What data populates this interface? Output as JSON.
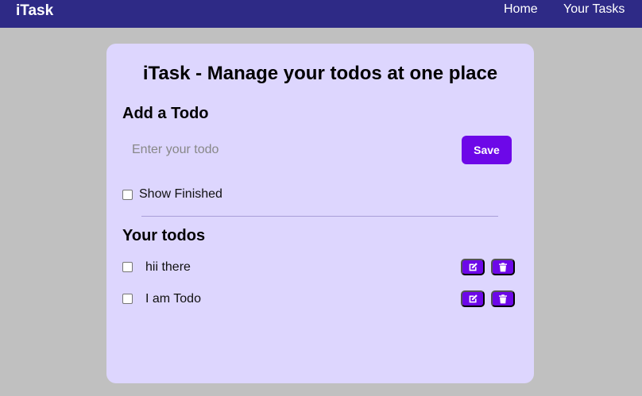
{
  "navbar": {
    "brand": "iTask",
    "links": [
      {
        "label": "Home"
      },
      {
        "label": "Your Tasks"
      }
    ]
  },
  "main": {
    "title": "iTask - Manage your todos at one place",
    "add_section": {
      "title": "Add a Todo",
      "input_placeholder": "Enter your todo",
      "input_value": "",
      "save_label": "Save"
    },
    "show_finished": {
      "label": "Show Finished",
      "checked": false
    },
    "todos_section": {
      "title": "Your todos",
      "items": [
        {
          "text": "hii there",
          "checked": false
        },
        {
          "text": "I am Todo",
          "checked": false
        }
      ]
    }
  },
  "icons": {
    "edit": "edit-icon",
    "delete": "trash-icon"
  },
  "colors": {
    "navbar_bg": "#2e2a86",
    "page_bg": "#c0c0c0",
    "card_bg": "#ddd6fe",
    "accent": "#6d08e8"
  }
}
